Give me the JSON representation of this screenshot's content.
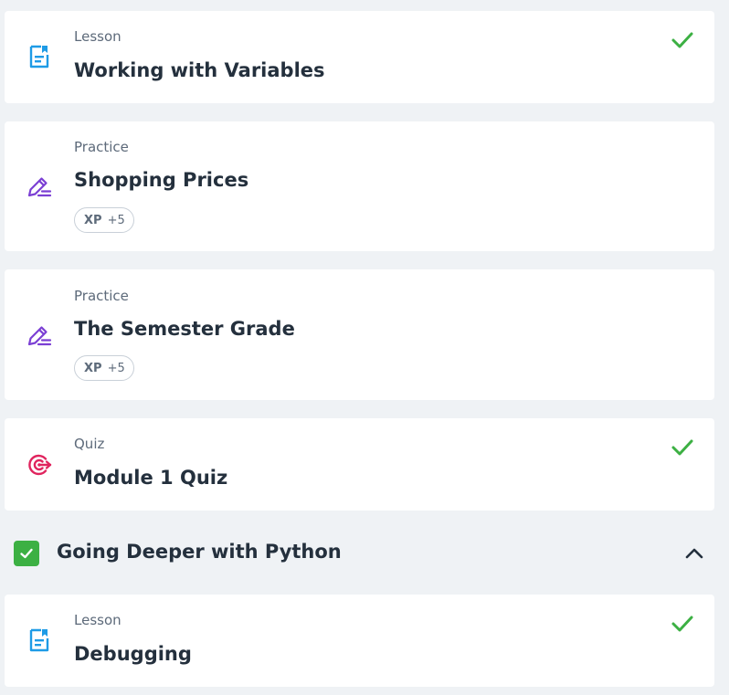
{
  "items": [
    {
      "kind": "Lesson",
      "title": "Working with Variables",
      "icon": "lesson-document-icon",
      "completed": true
    },
    {
      "kind": "Practice",
      "title": "Shopping Prices",
      "icon": "practice-pencil-icon",
      "xp_label": "XP",
      "xp_value": "+5",
      "completed": false
    },
    {
      "kind": "Practice",
      "title": "The Semester Grade",
      "icon": "practice-pencil-icon",
      "xp_label": "XP",
      "xp_value": "+5",
      "completed": false
    },
    {
      "kind": "Quiz",
      "title": "Module 1 Quiz",
      "icon": "quiz-target-icon",
      "completed": true
    }
  ],
  "section": {
    "title": "Going Deeper with Python",
    "completed": true,
    "expanded": true,
    "items": [
      {
        "kind": "Lesson",
        "title": "Debugging",
        "icon": "lesson-document-icon",
        "completed": true
      }
    ]
  },
  "colors": {
    "background": "#eff2f5",
    "card": "#ffffff",
    "lesson_icon": "#1e9be6",
    "practice_icon": "#7b3fd4",
    "quiz_icon": "#e0245e",
    "check": "#3cb043",
    "title_text": "#24303d",
    "kind_text": "#5d6a7a"
  }
}
